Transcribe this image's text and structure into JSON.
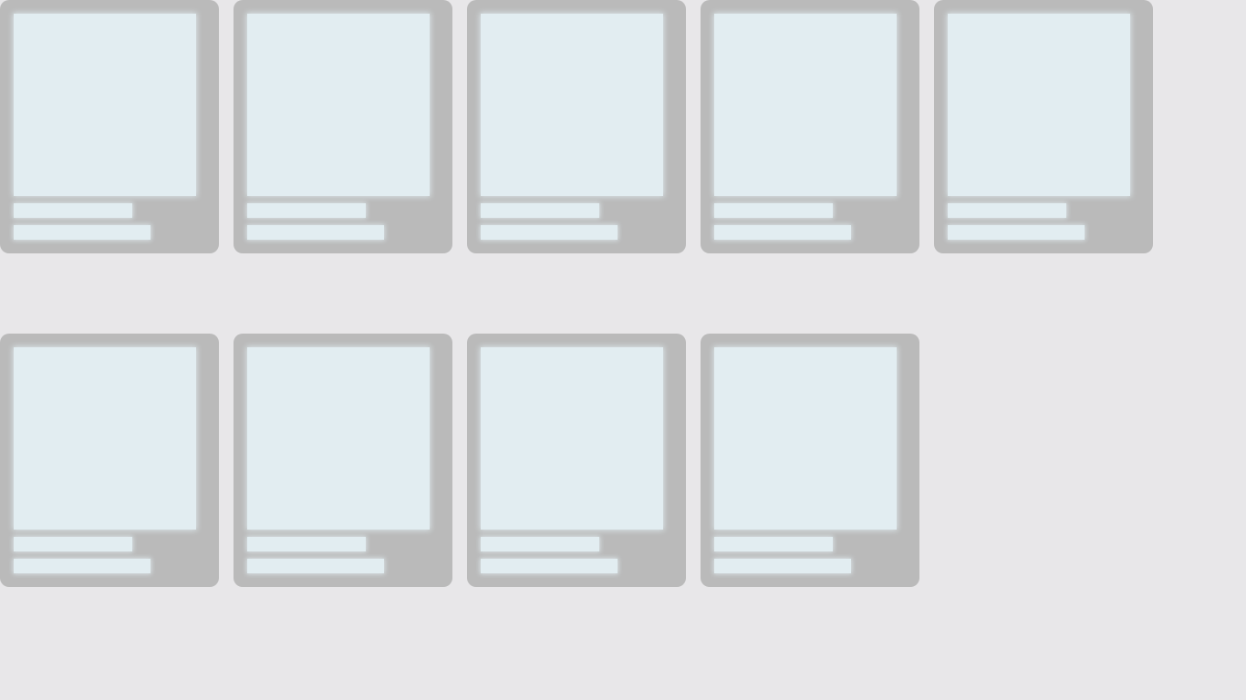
{
  "page": {
    "state": "loading",
    "background_color": "#e8e7e9"
  },
  "grid": {
    "card_count": 9,
    "card_color": "#bababa",
    "placeholder_color": "#e2edf1"
  }
}
